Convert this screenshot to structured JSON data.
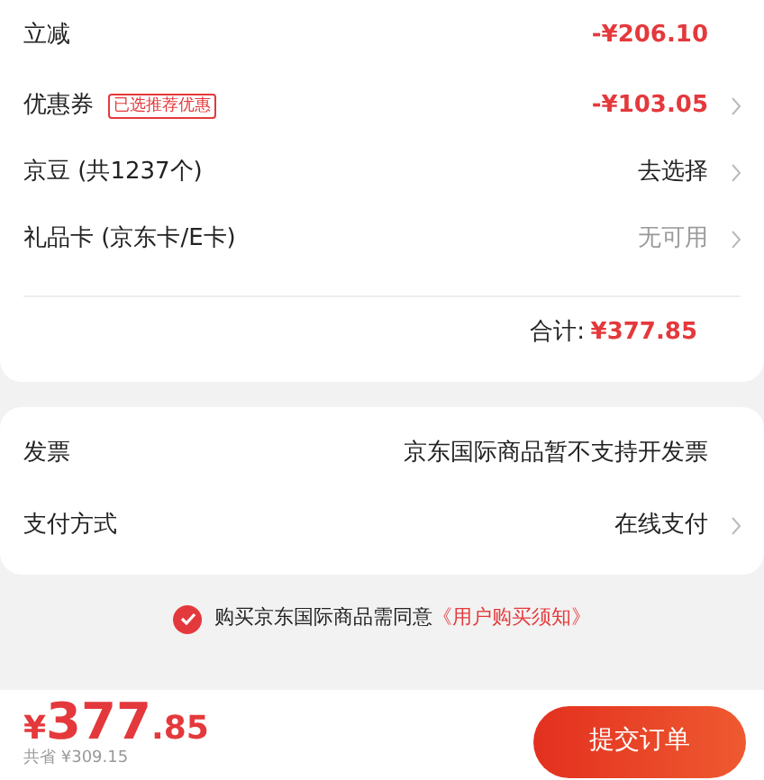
{
  "discount_rows": [
    {
      "label": "立减",
      "value": "-¥206.10",
      "kind": "discount",
      "arrow": false
    },
    {
      "label": "优惠券",
      "tag": "已选推荐优惠",
      "value": "-¥103.05",
      "kind": "discount",
      "arrow": true
    },
    {
      "label": "京豆 (共1237个)",
      "value": "去选择",
      "kind": "normal",
      "arrow": true
    },
    {
      "label": "礼品卡 (京东卡/E卡)",
      "value": "无可用",
      "kind": "muted",
      "arrow": true
    }
  ],
  "total": {
    "label": "合计:",
    "value": "¥377.85"
  },
  "info_rows": [
    {
      "label": "发票",
      "value": "京东国际商品暂不支持开发票",
      "arrow": false
    },
    {
      "label": "支付方式",
      "value": "在线支付",
      "arrow": true
    }
  ],
  "agreement": {
    "checked": true,
    "text": "购买京东国际商品需同意",
    "link": "《用户购买须知》"
  },
  "footer": {
    "currency": "¥",
    "price_int": "377",
    "price_dec": ".85",
    "saved": "共省 ¥309.15",
    "submit": "提交订单"
  }
}
